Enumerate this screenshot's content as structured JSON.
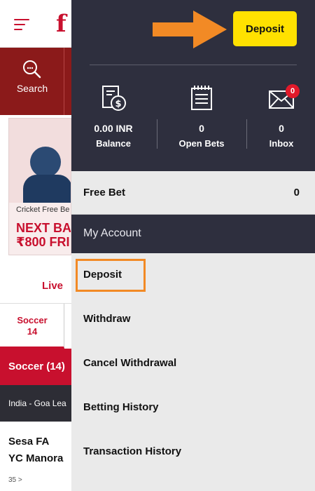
{
  "background": {
    "logo_text": "f",
    "search_label": "Search",
    "promo": {
      "caption": "Cricket Free Be",
      "headline1": "NEXT BA",
      "headline2": "₹800 FRI"
    },
    "live_tab": "Live",
    "sport_tab": {
      "name": "Soccer",
      "count": "14"
    },
    "soccer_header": "Soccer  (14)",
    "league": "India - Goa Lea",
    "match": {
      "team1": "Sesa FA",
      "team2": "YC Manora",
      "markets": "35 >"
    }
  },
  "drawer": {
    "deposit_button": "Deposit",
    "stats": [
      {
        "value": "0.00 INR",
        "label": "Balance",
        "icon": "money-receipt-icon"
      },
      {
        "value": "0",
        "label": "Open Bets",
        "icon": "bet-slip-icon"
      },
      {
        "value": "0",
        "label": "Inbox",
        "icon": "envelope-icon",
        "badge": "0"
      }
    ],
    "free_bet": {
      "label": "Free Bet",
      "value": "0"
    },
    "section_title": "My Account",
    "menu": [
      {
        "label": "Deposit"
      },
      {
        "label": "Withdraw"
      },
      {
        "label": "Cancel Withdrawal"
      },
      {
        "label": "Betting History"
      },
      {
        "label": "Transaction History"
      }
    ]
  },
  "colors": {
    "drawer_dark": "#2e2f3e",
    "brand_red": "#c8102e",
    "deposit_yellow": "#ffe100",
    "highlight_orange": "#f28a25"
  }
}
